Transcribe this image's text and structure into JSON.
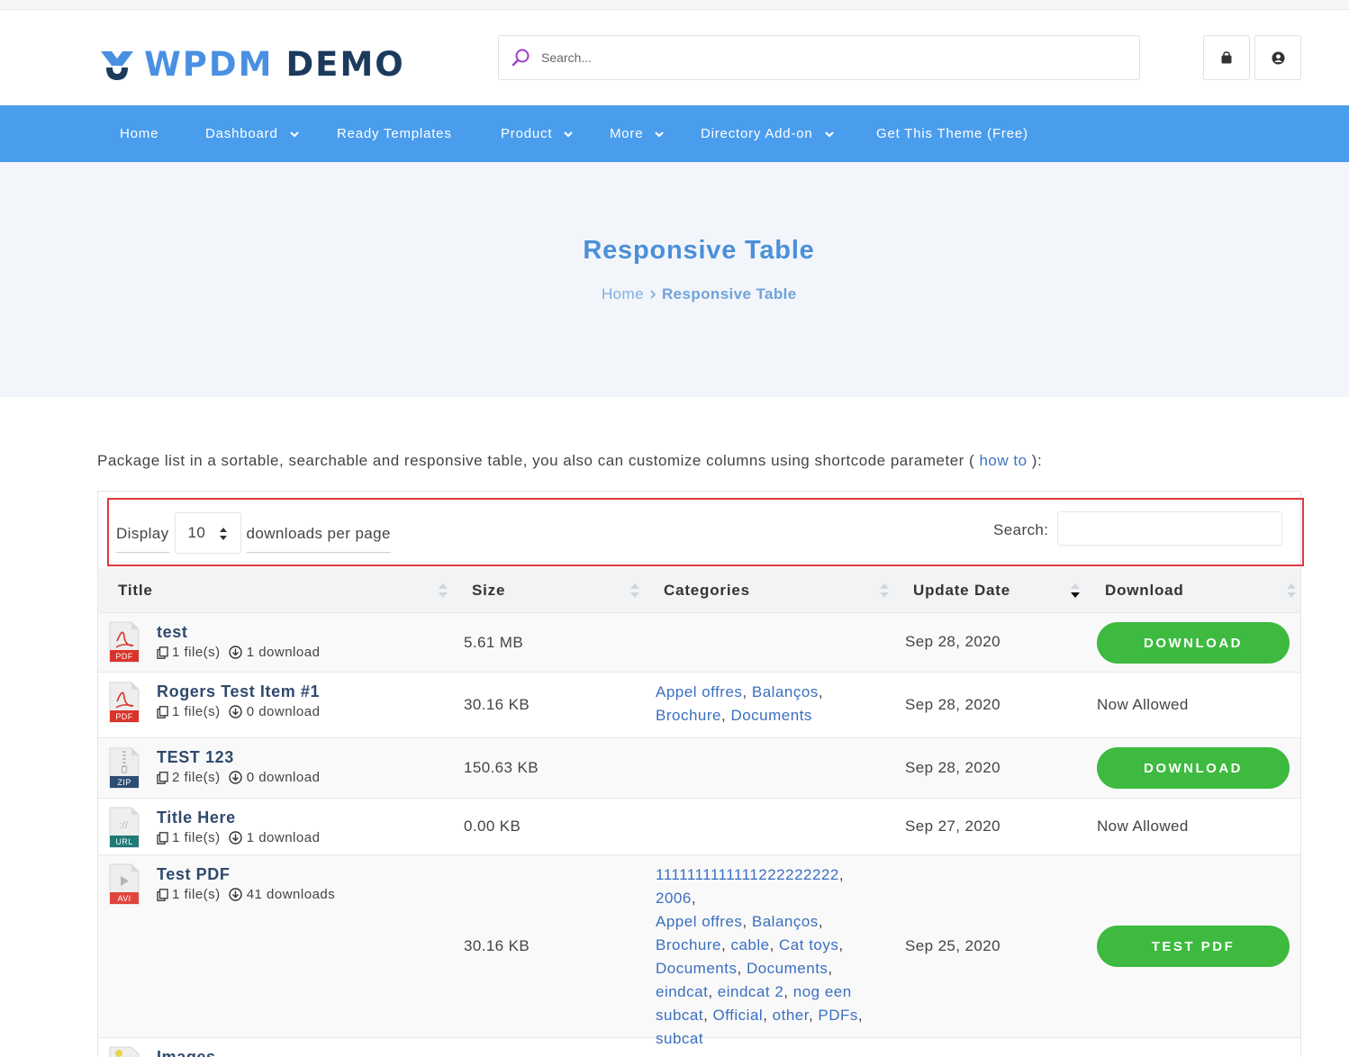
{
  "site": {
    "logo_text_1": "WPDM",
    "logo_text_2": "DEMO",
    "search_placeholder": "Search...",
    "cart_icon": "shopping-bag-icon",
    "user_icon": "user-circle-icon"
  },
  "nav": {
    "items": [
      {
        "label": "Home",
        "dropdown": false
      },
      {
        "label": "Dashboard",
        "dropdown": true
      },
      {
        "label": "Ready Templates",
        "dropdown": false
      },
      {
        "label": "Product",
        "dropdown": true
      },
      {
        "label": "More",
        "dropdown": true
      },
      {
        "label": "Directory Add-on",
        "dropdown": true
      },
      {
        "label": "Get This Theme (Free)",
        "dropdown": false
      }
    ]
  },
  "hero": {
    "title": "Responsive Table",
    "breadcrumb_home": "Home",
    "breadcrumb_current": "Responsive Table"
  },
  "intro": {
    "text": "Package list in a sortable, searchable and responsive table, you also can customize columns using shortcode parameter (",
    "link": "how to",
    "suffix": "):"
  },
  "controls": {
    "display_label": "Display",
    "per_page_value": "10",
    "per_page_suffix": "downloads per page",
    "search_label": "Search:"
  },
  "table": {
    "columns": [
      "Title",
      "Size",
      "Categories",
      "Update Date",
      "Download"
    ],
    "rows": [
      {
        "title": "test",
        "filetype": "PDF",
        "files": "1 file(s)",
        "downloads": "1 download",
        "size": "5.61 MB",
        "categories": [],
        "date": "Sep 28, 2020",
        "action": "DOWNLOAD",
        "action_type": "button"
      },
      {
        "title": "Rogers Test Item #1",
        "filetype": "PDF",
        "files": "1 file(s)",
        "downloads": "0 download",
        "size": "30.16 KB",
        "categories": [
          "Appel offres",
          "Balanços",
          "Brochure",
          "Documents"
        ],
        "date": "Sep 28, 2020",
        "action": "Now Allowed",
        "action_type": "text"
      },
      {
        "title": "TEST 123",
        "filetype": "ZIP",
        "files": "2 file(s)",
        "downloads": "0 download",
        "size": "150.63 KB",
        "categories": [],
        "date": "Sep 28, 2020",
        "action": "DOWNLOAD",
        "action_type": "button"
      },
      {
        "title": "Title Here",
        "filetype": "URL",
        "files": "1 file(s)",
        "downloads": "1 download",
        "size": "0.00 KB",
        "categories": [],
        "date": "Sep 27, 2020",
        "action": "Now Allowed",
        "action_type": "text"
      },
      {
        "title": "Test PDF",
        "filetype": "AVI",
        "files": "1 file(s)",
        "downloads": "41 downloads",
        "size": "30.16 KB",
        "categories": [
          "1111111111111222222222",
          "2006",
          "Appel offres",
          "Balanços",
          "Brochure",
          "cable",
          "Cat toys",
          "Documents",
          "Documents",
          "eindcat",
          "eindcat 2",
          "nog een subcat",
          "Official",
          "other",
          "PDFs",
          "subcat"
        ],
        "date": "Sep 25, 2020",
        "action": "TEST PDF",
        "action_type": "button"
      },
      {
        "title": "Images",
        "filetype": "IMG",
        "files": "",
        "downloads": "",
        "size": "",
        "categories": [],
        "date": "",
        "action": "",
        "action_type": "text"
      }
    ]
  },
  "colors": {
    "nav_bg": "#4a9ded",
    "accent_title": "#4a8fd9",
    "button_green": "#3dba3f",
    "highlight_border": "#e0393e",
    "pdf_red": "#d9342b",
    "zip_blue": "#2d4e73",
    "url_teal": "#1f7a76",
    "avi_red": "#e0453b"
  }
}
